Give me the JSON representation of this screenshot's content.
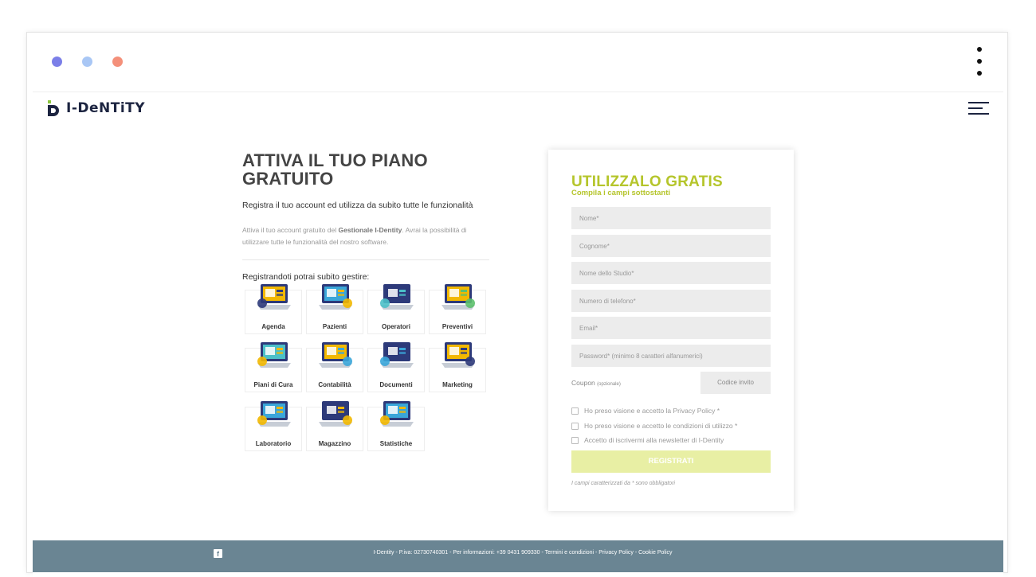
{
  "window": {
    "dot_colors": [
      "#7b7fe8",
      "#a9c7f5",
      "#f4907a"
    ]
  },
  "header": {
    "logo_text": "I-DeNTiTY",
    "logo_color": "#1c2440",
    "logo_accent": "#8cc63f"
  },
  "intro": {
    "title": "ATTIVA IL TUO PIANO GRATUITO",
    "subtitle": "Registra il tuo account ed utilizza da subito tutte le funzionalità",
    "desc_start": "Attiva il tuo account gratuito del ",
    "desc_bold": "Gestionale I-Dentity",
    "desc_end": ". Avrai la possibilità di utilizzare tutte le funzionalità del nostro software.",
    "features_heading": "Registrandoti potrai subito gestire:"
  },
  "features": [
    {
      "label": "Agenda",
      "icon": "agenda-icon"
    },
    {
      "label": "Pazienti",
      "icon": "pazienti-icon"
    },
    {
      "label": "Operatori",
      "icon": "operatori-icon"
    },
    {
      "label": "Preventivi",
      "icon": "preventivi-icon"
    },
    {
      "label": "Piani di Cura",
      "icon": "piani-di-cura-icon"
    },
    {
      "label": "Contabilità",
      "icon": "contabilita-icon"
    },
    {
      "label": "Documenti",
      "icon": "documenti-icon"
    },
    {
      "label": "Marketing",
      "icon": "marketing-icon"
    },
    {
      "label": "Laboratorio",
      "icon": "laboratorio-icon"
    },
    {
      "label": "Magazzino",
      "icon": "magazzino-icon"
    },
    {
      "label": "Statistiche",
      "icon": "statistiche-icon"
    }
  ],
  "form": {
    "title": "UTILIZZALO GRATIS",
    "subtitle": "Compila i campi sottostanti",
    "accent_color": "#b5c52b",
    "fields": [
      {
        "placeholder": "Nome*"
      },
      {
        "placeholder": "Cognome*"
      },
      {
        "placeholder": "Nome dello Studio*"
      },
      {
        "placeholder": "Numero di telefono*"
      },
      {
        "placeholder": "Email*"
      },
      {
        "placeholder": "Password* (minimo 8 caratteri alfanumerici)"
      }
    ],
    "coupon_label": "Coupon",
    "coupon_optional": "(opzionale)",
    "coupon_button": "Codice invito",
    "checkboxes": [
      {
        "label": "Ho preso visione e accetto la Privacy Policy *"
      },
      {
        "label": "Ho preso visione e accetto le condizioni di utilizzo *"
      },
      {
        "label": "Accetto di iscrivermi alla newsletter di I-Dentity"
      }
    ],
    "submit_label": "REGISTRATI",
    "required_note": "I campi caratterizzati da * sono obbligatori"
  },
  "footer": {
    "text": "I-Dentity - P.iva: 02730740301 - Per informazioni: +39 0431 909330 - Termini e condizioni - Privacy Policy - Cookie Policy",
    "background": "#6a8593"
  }
}
